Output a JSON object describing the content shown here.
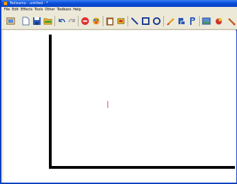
{
  "window": {
    "title": "Tedixamo - untitled - *"
  },
  "menubar": {
    "items": [
      "File",
      "Edit",
      "Effects",
      "Tools",
      "Other",
      "Toolbars",
      "Help"
    ]
  },
  "toolbar": {
    "buttons": [
      "open-album-icon",
      "new-document-icon",
      "save-icon",
      "open-folder-icon",
      "undo-icon",
      "redo-icon",
      "stop-icon",
      "effects-icon",
      "paste-icon",
      "stamp-icon",
      "line-tool-icon",
      "rectangle-tool-icon",
      "ellipse-tool-icon",
      "pencil-tool-icon",
      "fill-tool-icon",
      "select-tool-icon",
      "image-icon",
      "color-picker-icon",
      "brush-tool-icon"
    ]
  },
  "colors": {
    "titlebar": "#0a4fd8",
    "chrome": "#ece9d8",
    "canvas": "#ffffff",
    "drawing": "#000000",
    "cursor": "#e05050"
  }
}
